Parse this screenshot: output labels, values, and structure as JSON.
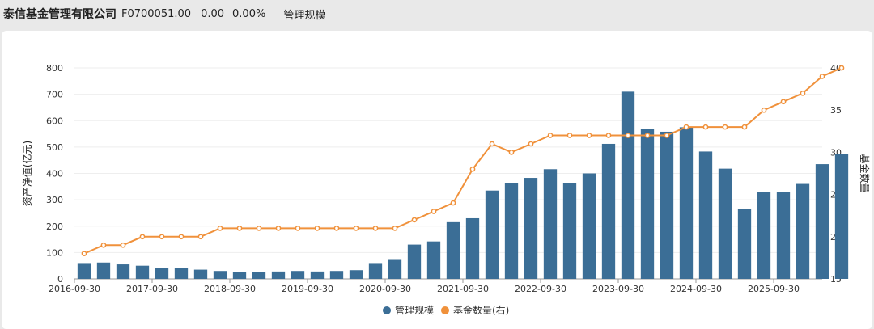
{
  "header": {
    "company": "泰信基金管理有限公司",
    "code": "F0700051.00",
    "price": "0.00",
    "change": "0.00%",
    "tab_label": "管理规模"
  },
  "chart_data": {
    "type": "bar",
    "categories": [
      "2016-09-30",
      "2016-12-31",
      "2017-03-31",
      "2017-06-30",
      "2017-09-30",
      "2017-12-31",
      "2018-03-31",
      "2018-06-30",
      "2018-09-30",
      "2018-12-31",
      "2019-03-31",
      "2019-06-30",
      "2019-09-30",
      "2019-12-31",
      "2020-03-31",
      "2020-06-30",
      "2020-09-30",
      "2020-12-31",
      "2021-03-31",
      "2021-06-30",
      "2021-09-30",
      "2021-12-31",
      "2022-03-31",
      "2022-06-30",
      "2022-09-30",
      "2022-12-31",
      "2023-03-31",
      "2023-06-30",
      "2023-09-30",
      "2023-12-31",
      "2024-03-31",
      "2024-06-30",
      "2024-09-30",
      "2024-12-31",
      "2025-03-31",
      "2025-06-30",
      "2025-09-30",
      "2025-12-31",
      "2026-03-31"
    ],
    "x_tick_labels": [
      "2016-09-30",
      "2017-09-30",
      "2018-09-30",
      "2019-09-30",
      "2020-09-30",
      "2021-09-30",
      "2022-09-30",
      "2023-09-30",
      "2024-09-30",
      "2025-09-30"
    ],
    "series": [
      {
        "name": "管理规模",
        "axis": "left",
        "type": "bar",
        "color": "#3b6e96",
        "values": [
          60,
          62,
          55,
          50,
          42,
          40,
          35,
          30,
          25,
          25,
          28,
          30,
          28,
          30,
          33,
          60,
          72,
          130,
          142,
          215,
          230,
          335,
          362,
          383,
          416,
          362,
          400,
          512,
          710,
          570,
          558,
          575,
          483,
          418,
          265,
          330,
          328,
          360,
          435,
          475
        ]
      },
      {
        "name": "基金数量(右)",
        "axis": "right",
        "type": "line",
        "color": "#f0913b",
        "values": [
          18,
          19,
          19,
          20,
          20,
          20,
          20,
          21,
          21,
          21,
          21,
          21,
          21,
          21,
          21,
          21,
          21,
          22,
          23,
          24,
          28,
          31,
          30,
          31,
          32,
          32,
          32,
          32,
          32,
          32,
          32,
          33,
          33,
          33,
          33,
          35,
          36,
          37,
          39,
          40
        ]
      }
    ],
    "ylabel": "资产净值(亿元)",
    "y2label": "基金数量",
    "ylim": [
      0,
      800
    ],
    "y_ticks": [
      0,
      100,
      200,
      300,
      400,
      500,
      600,
      700,
      800
    ],
    "y2lim": [
      15,
      40
    ],
    "y2_ticks": [
      15,
      20,
      25,
      30,
      35,
      40
    ],
    "grid": true,
    "legend_position": "bottom-center"
  }
}
